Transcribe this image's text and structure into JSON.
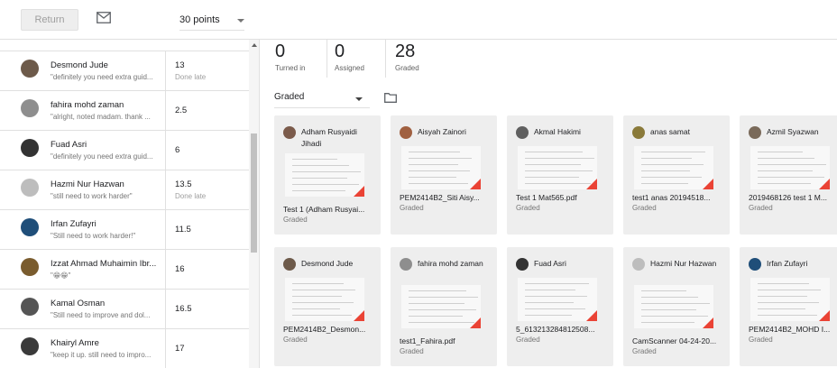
{
  "toolbar": {
    "return_label": "Return",
    "points_label": "30 points"
  },
  "students": [
    {
      "name": "Desmond Jude",
      "comment": "\"definitely you need extra guid...",
      "score": "13",
      "late": "Done late",
      "avatar_color": "#6d5a4a"
    },
    {
      "name": "fahira mohd zaman",
      "comment": "\"alright, noted madam. thank ...",
      "score": "2.5",
      "late": "",
      "avatar_color": "#8e8e8e"
    },
    {
      "name": "Fuad Asri",
      "comment": "\"definitely you need extra guid...",
      "score": "6",
      "late": "",
      "avatar_color": "#333333"
    },
    {
      "name": "Hazmi Nur Hazwan",
      "comment": "\"still need to work harder\"",
      "score": "13.5",
      "late": "Done late",
      "avatar_color": "#bdbdbd"
    },
    {
      "name": "Irfan Zufayri",
      "comment": "\"Still need to work harder!\"",
      "score": "11.5",
      "late": "",
      "avatar_color": "#1f4e79"
    },
    {
      "name": "Izzat Ahmad Muhaimin Ibr...",
      "comment": "\"😁😁\"",
      "score": "16",
      "late": "",
      "avatar_color": "#7a5c2e"
    },
    {
      "name": "Kamal Osman",
      "comment": "\"Still need to improve and dol...",
      "score": "16.5",
      "late": "",
      "avatar_color": "#555555"
    },
    {
      "name": "Khairyl Amre",
      "comment": "\"keep it up. still need to impro...",
      "score": "17",
      "late": "",
      "avatar_color": "#3a3a3a"
    }
  ],
  "stats": [
    {
      "num": "0",
      "label": "Turned in"
    },
    {
      "num": "0",
      "label": "Assigned"
    },
    {
      "num": "28",
      "label": "Graded"
    }
  ],
  "filter": {
    "label": "Graded"
  },
  "cards": [
    {
      "name": "Adham Rusyaidi Jihadi",
      "file": "Test 1 (Adham Rusyai...",
      "status": "Graded",
      "avatar_color": "#7b5b4b"
    },
    {
      "name": "Aisyah Zainori",
      "file": "PEM2414B2_Siti Aisy...",
      "status": "Graded",
      "avatar_color": "#a06040"
    },
    {
      "name": "Akmal Hakimi",
      "file": "Test 1 Mat565.pdf",
      "status": "Graded",
      "avatar_color": "#606060"
    },
    {
      "name": "anas samat",
      "file": "test1 anas 20194518...",
      "status": "Graded",
      "avatar_color": "#8a7a3a"
    },
    {
      "name": "Azmil Syazwan",
      "file": "2019468126 test 1 M...",
      "status": "Graded",
      "avatar_color": "#7a6a5a"
    },
    {
      "name": "Desmond Jude",
      "file": "PEM2414B2_Desmon...",
      "status": "Graded",
      "avatar_color": "#6d5a4a"
    },
    {
      "name": "fahira mohd zaman",
      "file": "test1_Fahira.pdf",
      "status": "Graded",
      "avatar_color": "#8e8e8e"
    },
    {
      "name": "Fuad Asri",
      "file": "5_613213284812508...",
      "status": "Graded",
      "avatar_color": "#333333"
    },
    {
      "name": "Hazmi Nur Hazwan",
      "file": "CamScanner 04-24-20...",
      "status": "Graded",
      "avatar_color": "#bdbdbd"
    },
    {
      "name": "Irfan Zufayri",
      "file": "PEM2414B2_MOHD I...",
      "status": "Graded",
      "avatar_color": "#1f4e79"
    }
  ]
}
